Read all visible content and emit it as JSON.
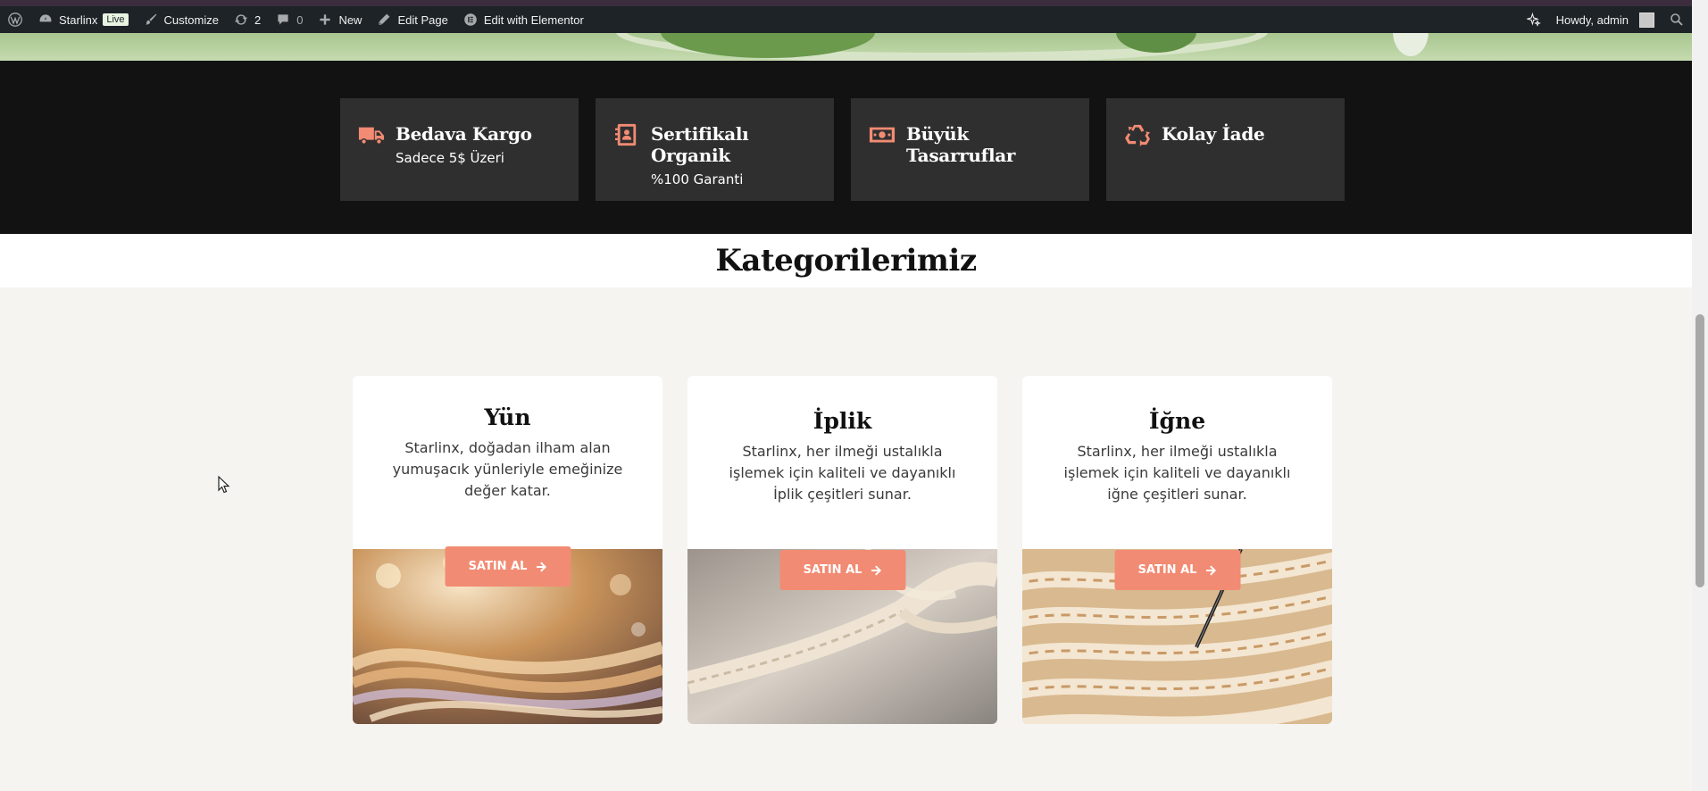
{
  "admin_bar": {
    "site_name": "Starlinx",
    "live_badge": "Live",
    "customize": "Customize",
    "revisions_count": "2",
    "comments_count": "0",
    "new": "New",
    "edit_page": "Edit Page",
    "edit_elementor": "Edit with Elementor",
    "howdy": "Howdy, admin"
  },
  "features": [
    {
      "title": "Bedava Kargo",
      "subtitle": "Sadece 5$ Üzeri",
      "icon": "truck-icon"
    },
    {
      "title": "Sertifikalı Organik",
      "subtitle": "%100 Garanti",
      "icon": "contact-book-icon"
    },
    {
      "title": "Büyük Tasarruflar",
      "subtitle": "",
      "icon": "money-bill-icon"
    },
    {
      "title": "Kolay İade",
      "subtitle": "",
      "icon": "recycle-icon"
    }
  ],
  "categories": {
    "title": "Kategorilerimiz",
    "items": [
      {
        "name": "Yün",
        "description": "Starlinx, doğadan ilham alan yumuşacık yünleriyle emeğinize değer katar.",
        "button": "SATIN AL"
      },
      {
        "name": "İplik",
        "description": "Starlinx, her ilmeği ustalıkla işlemek için kaliteli ve dayanıklı İplik çeşitleri sunar.",
        "button": "SATIN AL"
      },
      {
        "name": "İğne",
        "description": "Starlinx, her ilmeği ustalıkla işlemek için kaliteli ve dayanıklı iğne çeşitleri sunar.",
        "button": "SATIN AL"
      }
    ]
  },
  "colors": {
    "accent": "#f28b73",
    "dark_band": "#121212",
    "feature_box": "#2f2f2f",
    "admin_bar": "#1d2327"
  }
}
